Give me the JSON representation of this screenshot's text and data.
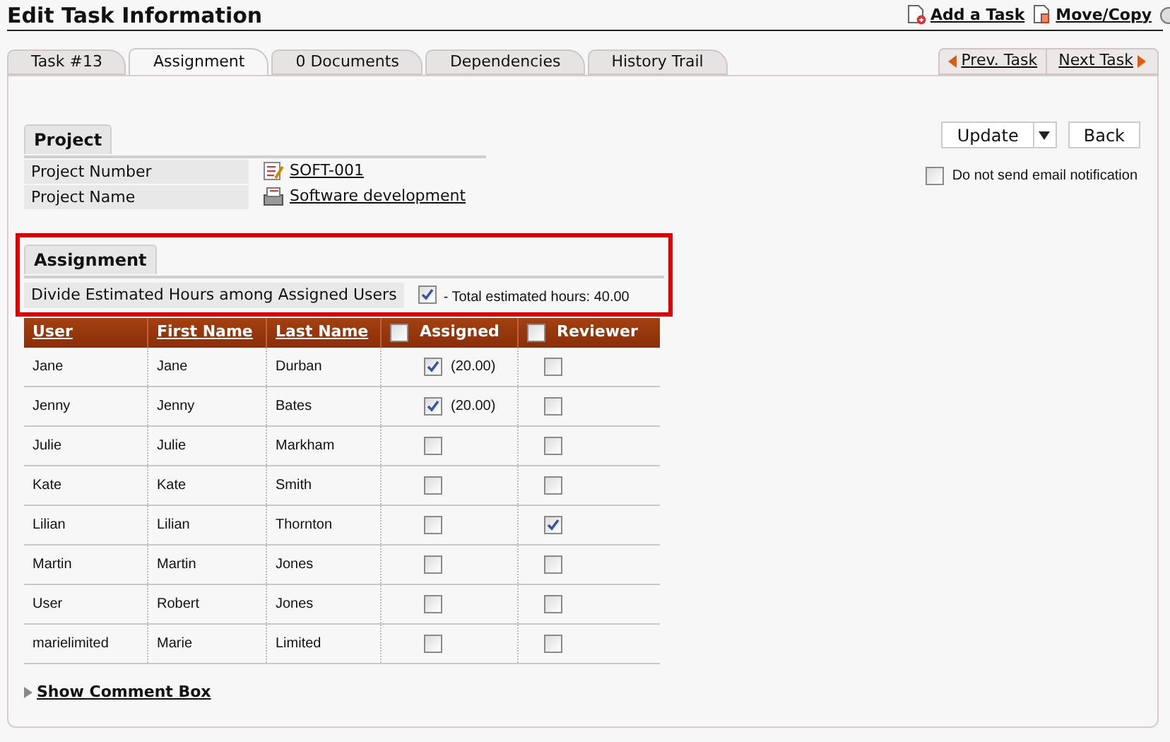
{
  "page_title": "Edit Task Information",
  "header_links": [
    {
      "kind": "add",
      "label": "Add a Task"
    },
    {
      "kind": "move",
      "label": "Move/Copy"
    }
  ],
  "tabs": [
    {
      "label": "Task #13",
      "selected": false
    },
    {
      "label": "Assignment",
      "selected": true
    },
    {
      "label": "0 Documents",
      "selected": false
    },
    {
      "label": "Dependencies",
      "selected": false
    },
    {
      "label": "History Trail",
      "selected": false
    }
  ],
  "pager": {
    "prev": "Prev. Task",
    "next": "Next Task"
  },
  "project": {
    "title": "Project",
    "rows": [
      {
        "kind": "number",
        "label": "Project Number",
        "value": "SOFT-001"
      },
      {
        "kind": "name",
        "label": "Project Name",
        "value": "Software development"
      }
    ]
  },
  "actions": {
    "update": "Update",
    "back": "Back",
    "no_email": {
      "label": "Do not send email notification",
      "checked": false
    }
  },
  "assignment": {
    "title": "Assignment",
    "divide_label": "Divide Estimated Hours among Assigned Users",
    "divide_checked": true,
    "total": "- Total estimated hours: 40.00"
  },
  "table": {
    "columns": [
      "User",
      "First Name",
      "Last Name",
      "Assigned",
      "Reviewer"
    ],
    "all_assigned": false,
    "all_reviewer": false,
    "rows": [
      {
        "user": "Jane",
        "first": "Jane",
        "last": "Durban",
        "assigned": true,
        "hours": "(20.00)",
        "reviewer": false
      },
      {
        "user": "Jenny",
        "first": "Jenny",
        "last": "Bates",
        "assigned": true,
        "hours": "(20.00)",
        "reviewer": false
      },
      {
        "user": "Julie",
        "first": "Julie",
        "last": "Markham",
        "assigned": false,
        "reviewer": false
      },
      {
        "user": "Kate",
        "first": "Kate",
        "last": "Smith",
        "assigned": false,
        "reviewer": false
      },
      {
        "user": "Lilian",
        "first": "Lilian",
        "last": "Thornton",
        "assigned": false,
        "reviewer": true
      },
      {
        "user": "Martin",
        "first": "Martin",
        "last": "Jones",
        "assigned": false,
        "reviewer": false
      },
      {
        "user": "User",
        "first": "Robert",
        "last": "Jones",
        "assigned": false,
        "reviewer": false
      },
      {
        "user": "marielimited",
        "first": "Marie",
        "last": "Limited",
        "assigned": false,
        "reviewer": false
      }
    ]
  },
  "comment_link": "Show Comment Box"
}
